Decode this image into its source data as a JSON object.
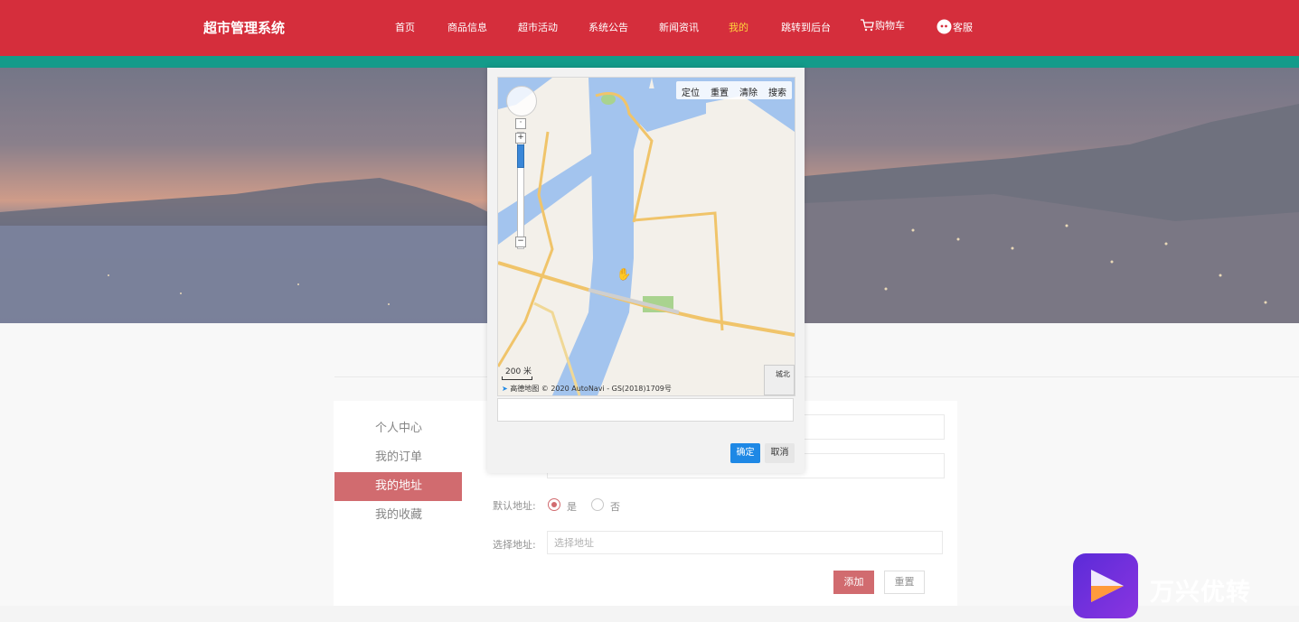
{
  "header": {
    "brand": "超市管理系统",
    "nav": [
      {
        "label": "首页"
      },
      {
        "label": "商品信息"
      },
      {
        "label": "超市活动"
      },
      {
        "label": "系统公告"
      },
      {
        "label": "新闻资讯"
      },
      {
        "label": "我的",
        "active": true
      },
      {
        "label": "跳转到后台"
      },
      {
        "label": "购物车",
        "icon": "cart-icon"
      },
      {
        "label": "客服",
        "icon": "chat-icon"
      }
    ],
    "colors": {
      "bar": "#d52e3c",
      "stripe": "#139b8a",
      "active_nav": "#ffd33d"
    }
  },
  "sidebar": {
    "items": [
      {
        "label": "个人中心"
      },
      {
        "label": "我的订单"
      },
      {
        "label": "我的地址",
        "active": true
      },
      {
        "label": "我的收藏"
      }
    ]
  },
  "form": {
    "default_label": "默认地址:",
    "yes": "是",
    "no": "否",
    "default_value": "是",
    "address_label": "选择地址:",
    "address_placeholder": "选择地址",
    "add_button": "添加",
    "reset_button": "重置"
  },
  "dialog": {
    "map_tools": [
      "定位",
      "重置",
      "清除",
      "搜索"
    ],
    "scale": "200 米",
    "copyright": "© 2020 AutoNavi - GS(2018)1709号",
    "provider": "高德地图",
    "overview_label": "城北",
    "confirm": "确定",
    "cancel": "取消"
  },
  "watermark": {
    "text": "万兴优转"
  }
}
